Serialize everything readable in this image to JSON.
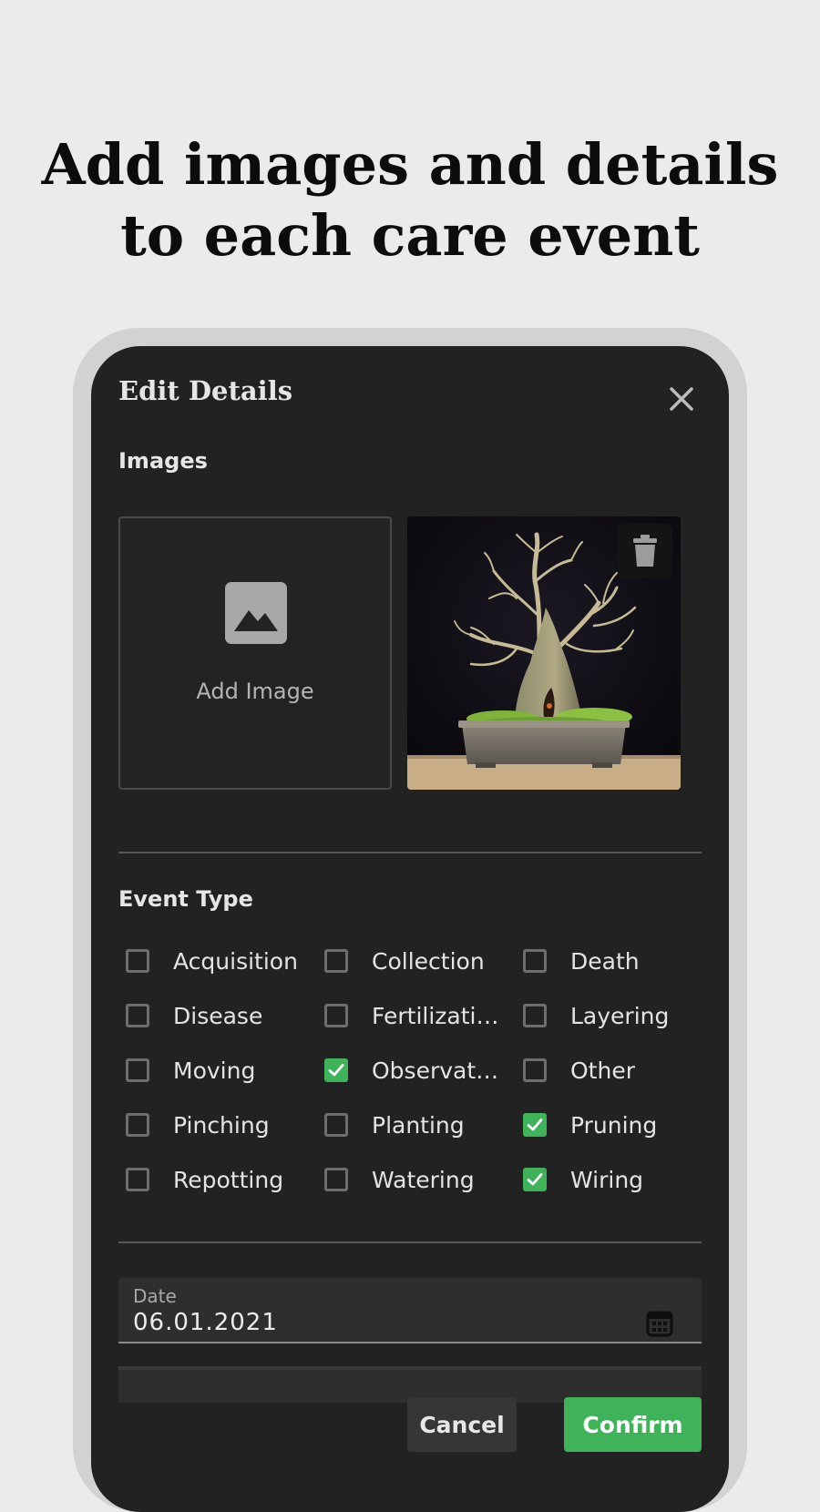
{
  "headline": {
    "line1": "Add images and details",
    "line2": "to each care event"
  },
  "dialog": {
    "title": "Edit Details",
    "close_icon": "close-icon",
    "images": {
      "label": "Images",
      "add_image_label": "Add Image",
      "add_image_icon": "image-placeholder-icon",
      "photo_subject": "bonsai-tree-photo",
      "delete_icon": "trash-icon"
    },
    "event_type": {
      "label": "Event Type",
      "options": [
        {
          "label": "Acquisition",
          "checked": false
        },
        {
          "label": "Collection",
          "checked": false
        },
        {
          "label": "Death",
          "checked": false
        },
        {
          "label": "Disease",
          "checked": false
        },
        {
          "label": "Fertilization",
          "checked": false
        },
        {
          "label": "Layering",
          "checked": false
        },
        {
          "label": "Moving",
          "checked": false
        },
        {
          "label": "Observation",
          "checked": true
        },
        {
          "label": "Other",
          "checked": false
        },
        {
          "label": "Pinching",
          "checked": false
        },
        {
          "label": "Planting",
          "checked": false
        },
        {
          "label": "Pruning",
          "checked": true
        },
        {
          "label": "Repotting",
          "checked": false
        },
        {
          "label": "Watering",
          "checked": false
        },
        {
          "label": "Wiring",
          "checked": true
        }
      ]
    },
    "date": {
      "caption": "Date",
      "value": "06.01.2021",
      "icon": "calendar-icon"
    },
    "buttons": {
      "cancel": "Cancel",
      "confirm": "Confirm"
    }
  },
  "colors": {
    "page_background": "#ebebeb",
    "dialog_background": "#222222",
    "accent_green": "#3fb35a",
    "frame_gray": "#d2d2d2"
  }
}
